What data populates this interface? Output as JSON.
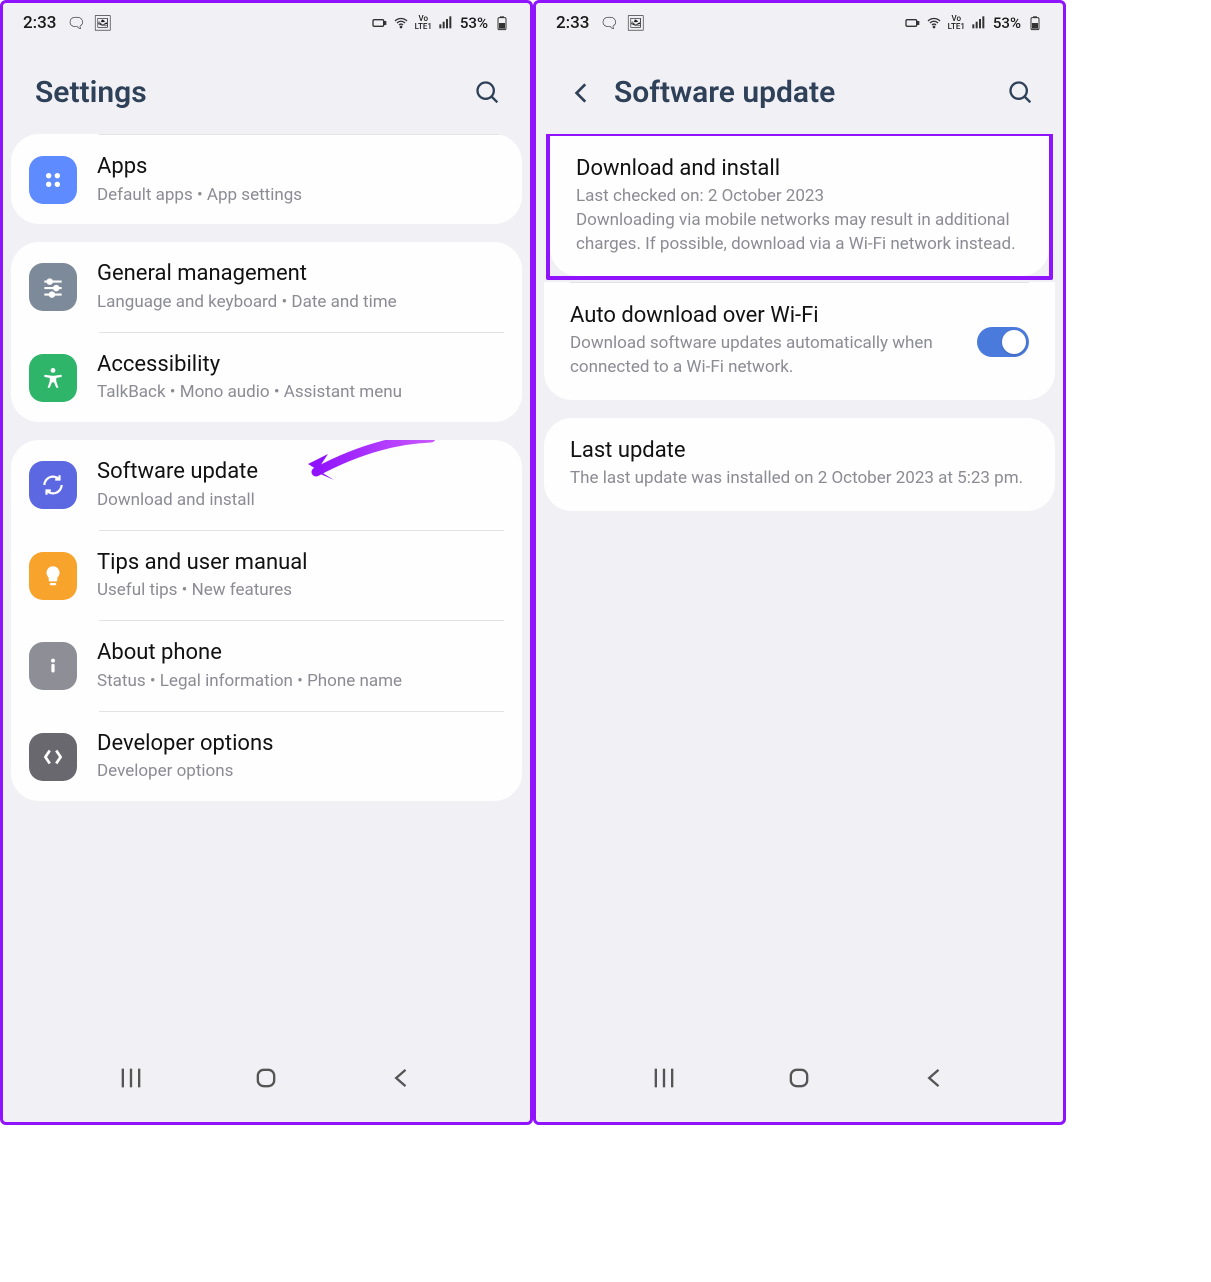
{
  "statusbar": {
    "time": "2:33",
    "battery": "53%",
    "net": "Vo LTE1"
  },
  "left": {
    "header": {
      "title": "Settings"
    },
    "cards": [
      {
        "rows": [
          {
            "icon": "apps",
            "color": "#5e8bff",
            "title": "Apps",
            "sub": "Default apps  •  App settings"
          }
        ],
        "peek": true
      },
      {
        "rows": [
          {
            "icon": "sliders",
            "color": "#7d8a99",
            "title": "General management",
            "sub": "Language and keyboard  •  Date and time"
          },
          {
            "icon": "accessibility",
            "color": "#2fb56a",
            "title": "Accessibility",
            "sub": "TalkBack  •  Mono audio  •  Assistant menu"
          }
        ]
      },
      {
        "rows": [
          {
            "icon": "update",
            "color": "#5c68e2",
            "title": "Software update",
            "sub": "Download and install",
            "pointer": true
          },
          {
            "icon": "tips",
            "color": "#f7a32c",
            "title": "Tips and user manual",
            "sub": "Useful tips  •  New features"
          },
          {
            "icon": "info",
            "color": "#8e8e97",
            "title": "About phone",
            "sub": "Status  •  Legal information  •  Phone name"
          },
          {
            "icon": "developer",
            "color": "#68686e",
            "title": "Developer options",
            "sub": "Developer options"
          }
        ]
      }
    ]
  },
  "right": {
    "header": {
      "title": "Software update"
    },
    "download": {
      "title": "Download and install",
      "line1": "Last checked on: 2 October 2023",
      "line2": "Downloading via mobile networks may result in additional charges. If possible, download via a Wi-Fi network instead."
    },
    "auto": {
      "title": "Auto download over Wi-Fi",
      "desc": "Download software updates automatically when connected to a Wi-Fi network.",
      "on": true
    },
    "last": {
      "title": "Last update",
      "desc": "The last update was installed on 2 October 2023 at 5:23 pm."
    }
  }
}
